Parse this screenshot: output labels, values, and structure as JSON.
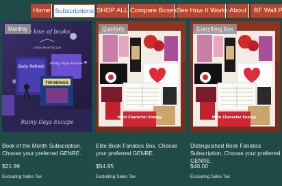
{
  "nav": {
    "items": [
      {
        "label": "Home"
      },
      {
        "label": "Subscriptions"
      },
      {
        "label": "SHOP ALL"
      },
      {
        "label": "Compare Boxes"
      },
      {
        "label": "See How It Works"
      },
      {
        "label": "About"
      },
      {
        "label": "BF Wall Pa"
      }
    ]
  },
  "products": [
    {
      "badge": "Monthly",
      "title": "Book of the Month Subscription. Choose your preferred GENRE.",
      "price": "$21.99",
      "tax": "Excluding Sales Tax",
      "image_text": {
        "top": "the love of books.",
        "brand": "Unbox Bruer Escape",
        "book1": "Body Refresh",
        "book2": "Rainy Days Escape",
        "tea": "TWININGS",
        "bottom": "Rainy Days Escape"
      }
    },
    {
      "badge": "Quarterly",
      "title": "Elite Book Fanatics Box. Choose your preferred GENRE.",
      "price": "$54.95",
      "tax": "Excluding Sales Tax",
      "image_text": {
        "sign": "Main Character Energy"
      }
    },
    {
      "badge": "Everything Box",
      "title": "Distinguished Book Fanatics Subscription. Choose your preferred GENRE.",
      "price": "$40.00",
      "tax": "Excluding Sales Tax",
      "image_text": {
        "sign": "Main Character Energy"
      }
    }
  ],
  "colors": {
    "background": "#1f4a45",
    "nav_button": "#b9432b",
    "nav_active_text": "#2b6cd6"
  }
}
